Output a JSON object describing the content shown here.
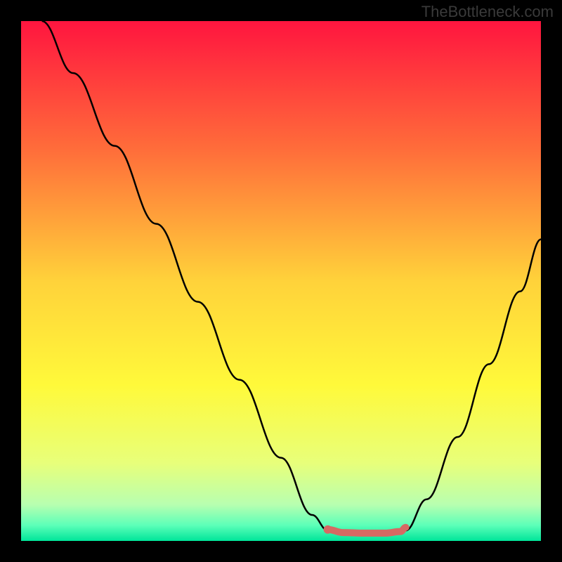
{
  "watermark": "TheBottleneck.com",
  "colors": {
    "background": "#000000",
    "curve": "#000000",
    "highlight": "#d66a63",
    "gradient_stops": [
      {
        "offset": 0.0,
        "color": "#ff153f"
      },
      {
        "offset": 0.25,
        "color": "#ff6e3a"
      },
      {
        "offset": 0.5,
        "color": "#ffd23a"
      },
      {
        "offset": 0.7,
        "color": "#fff93a"
      },
      {
        "offset": 0.85,
        "color": "#e8ff7a"
      },
      {
        "offset": 0.93,
        "color": "#b8ffb0"
      },
      {
        "offset": 0.97,
        "color": "#5cffb8"
      },
      {
        "offset": 1.0,
        "color": "#00e59a"
      }
    ]
  },
  "chart_data": {
    "type": "line",
    "title": "",
    "xlabel": "",
    "ylabel": "",
    "xlim": [
      0,
      100
    ],
    "ylim": [
      0,
      100
    ],
    "series": [
      {
        "name": "left-descending",
        "x": [
          4,
          10,
          18,
          26,
          34,
          42,
          50,
          56,
          59
        ],
        "y": [
          100,
          90,
          76,
          61,
          46,
          31,
          16,
          5,
          2
        ]
      },
      {
        "name": "right-ascending",
        "x": [
          74,
          78,
          84,
          90,
          96,
          100
        ],
        "y": [
          2,
          8,
          20,
          34,
          48,
          58
        ]
      },
      {
        "name": "highlight-segment",
        "x": [
          59,
          62,
          66,
          70,
          73,
          74
        ],
        "y": [
          2.2,
          1.6,
          1.5,
          1.5,
          1.8,
          2.6
        ]
      }
    ],
    "annotations": [
      {
        "type": "dot",
        "x": 59,
        "y": 2.2,
        "name": "highlight-start-dot"
      }
    ]
  }
}
